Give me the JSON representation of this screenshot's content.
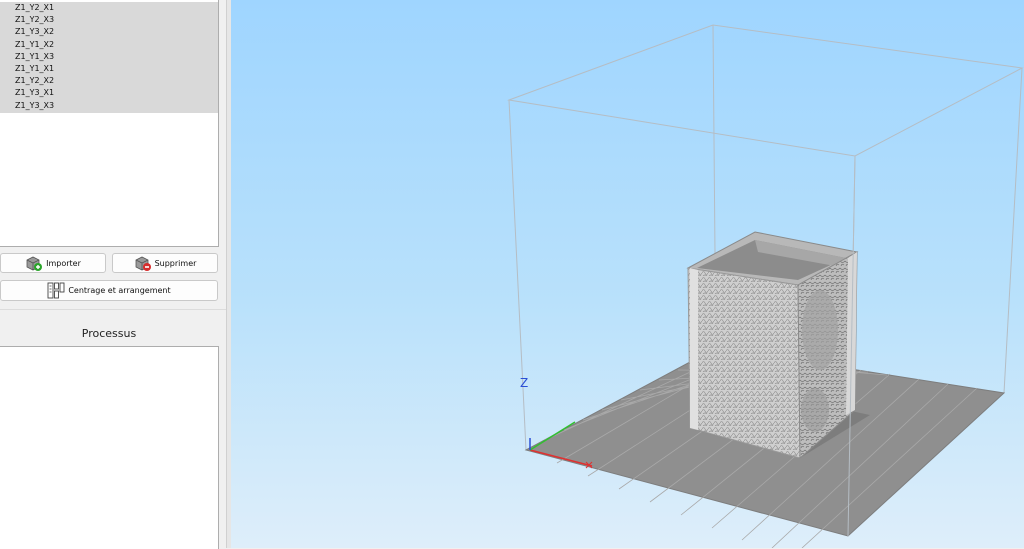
{
  "object_list": {
    "items": [
      "Z1_Y2_X1",
      "Z1_Y2_X3",
      "Z1_Y3_X2",
      "Z1_Y1_X2",
      "Z1_Y1_X3",
      "Z1_Y1_X1",
      "Z1_Y2_X2",
      "Z1_Y3_X1",
      "Z1_Y3_X3"
    ]
  },
  "buttons": {
    "import_label": "Importer",
    "delete_label": "Supprimer",
    "arrange_label": "Centrage et arrangement"
  },
  "process": {
    "title": "Processus"
  },
  "viewport": {
    "z_axis_label": "Z",
    "colors": {
      "x_axis": "#e03030",
      "y_axis": "#30c030",
      "z_axis": "#2a4fd6",
      "bed": "#8f8f8f",
      "model": "#c4c4c4"
    }
  }
}
